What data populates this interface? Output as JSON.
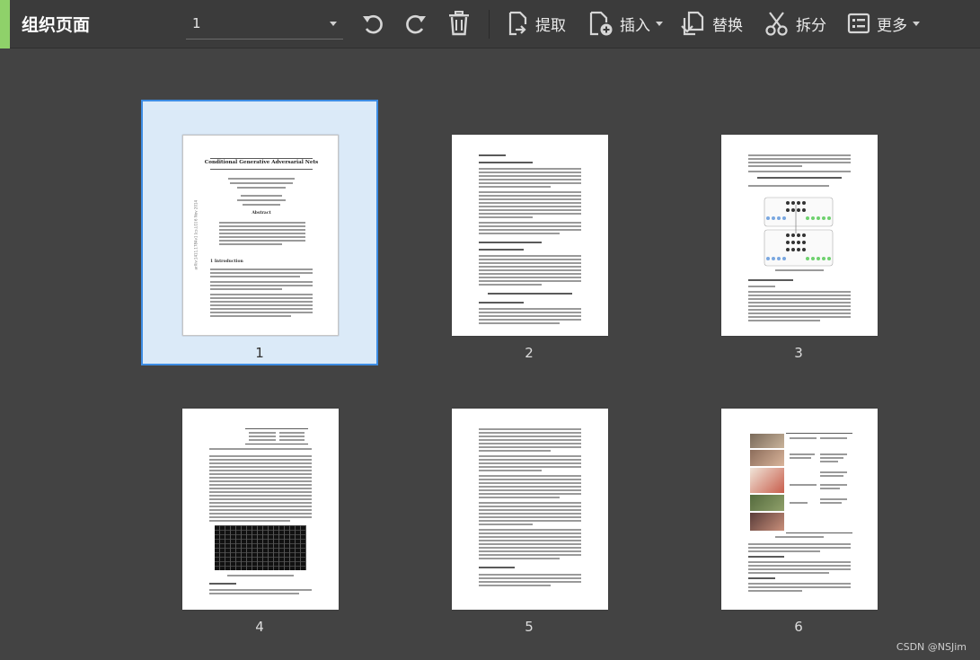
{
  "toolbar": {
    "title": "组织页面",
    "page_select_value": "1",
    "undo_icon": "undo-icon",
    "redo_icon": "redo-icon",
    "delete_icon": "trash-icon",
    "extract_label": "提取",
    "insert_label": "插入",
    "replace_label": "替换",
    "split_label": "拆分",
    "more_label": "更多",
    "accent_color": "#8fd16a"
  },
  "pages": [
    {
      "number": "1",
      "selected": true,
      "title": "Conditional Generative Adversarial Nets",
      "abstract_heading": "Abstract",
      "intro_heading": "1   Introduction",
      "side_text": "arXiv:1411.1784v1 [cs.LG] 6 Nov 2014"
    },
    {
      "number": "2",
      "selected": false
    },
    {
      "number": "3",
      "selected": false
    },
    {
      "number": "4",
      "selected": false
    },
    {
      "number": "5",
      "selected": false
    },
    {
      "number": "6",
      "selected": false
    }
  ],
  "watermark": "CSDN @NSJim"
}
